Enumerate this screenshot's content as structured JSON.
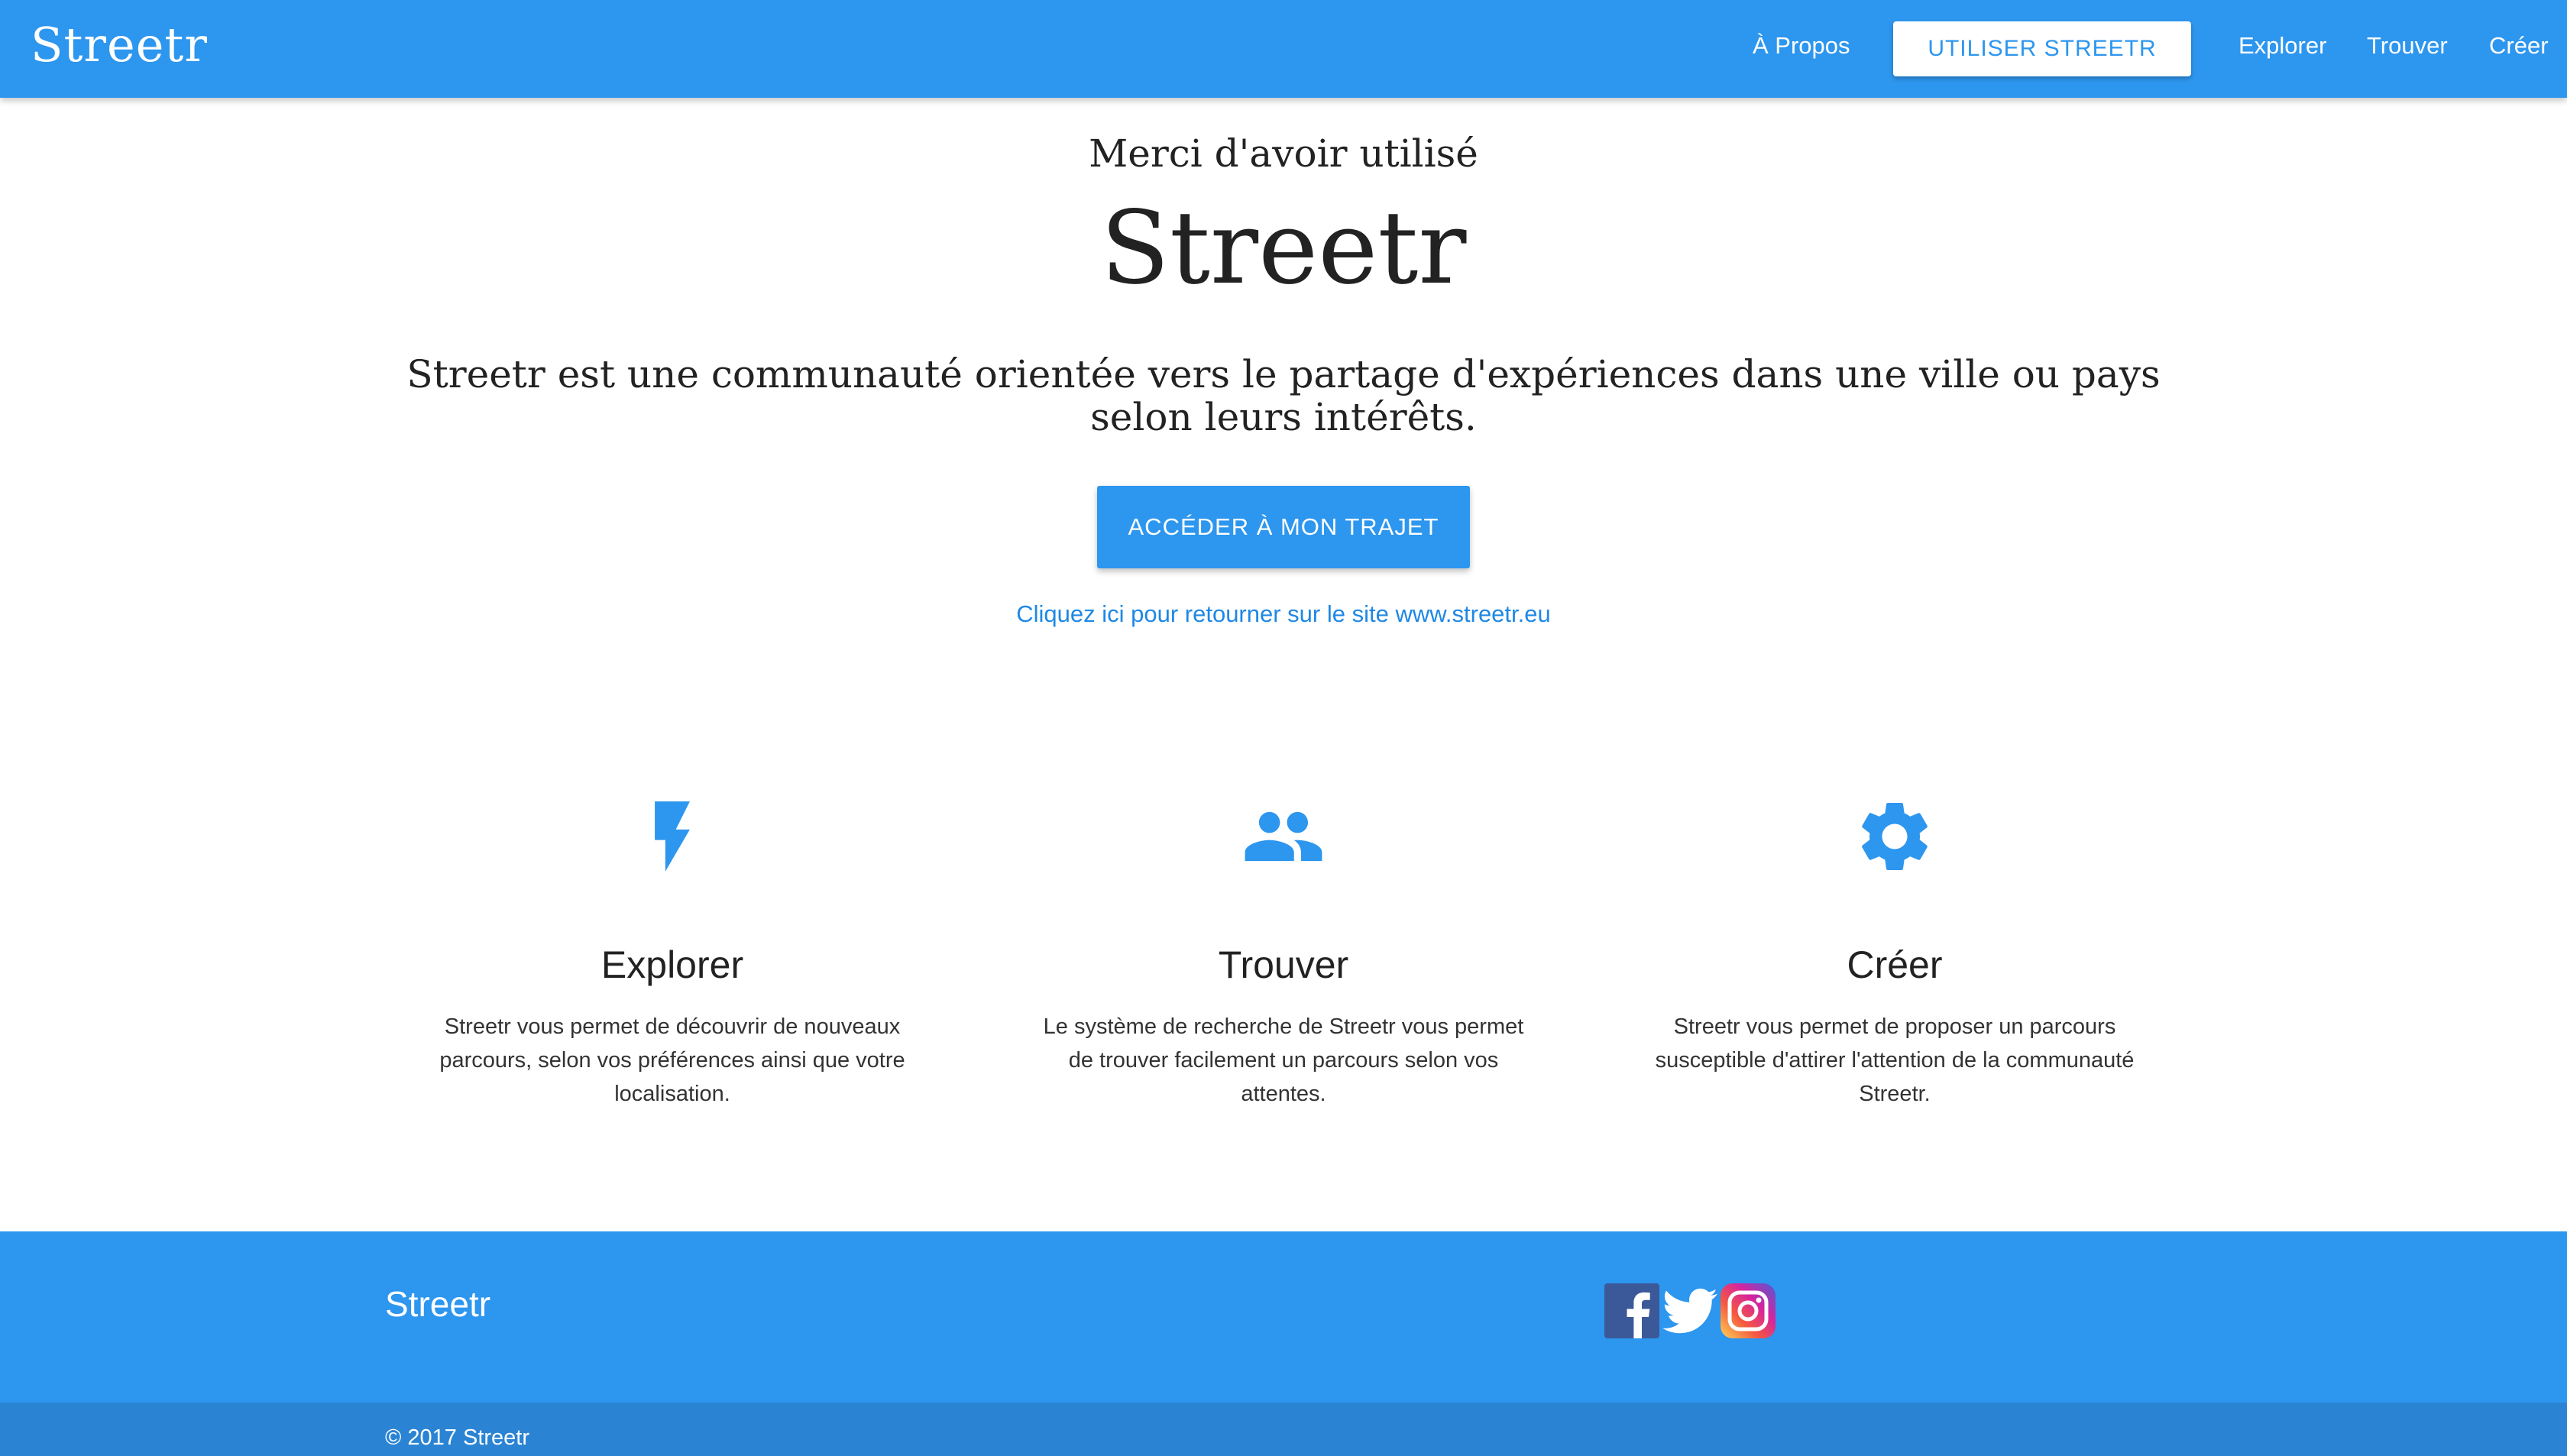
{
  "navbar": {
    "brand": "Streetr",
    "links": [
      "À Propos",
      "Explorer",
      "Trouver",
      "Créer"
    ],
    "cta_label": "UTILISER STREETR"
  },
  "hero": {
    "subtitle": "Merci d'avoir utilisé",
    "title": "Streetr",
    "description": "Streetr est une communauté orientée vers le partage d'expériences dans une ville ou pays selon leurs intérêts.",
    "button_label": "ACCÉDER À MON TRAJET",
    "back_link": "Cliquez ici pour retourner sur le site www.streetr.eu"
  },
  "features": [
    {
      "icon": "flash-icon",
      "title": "Explorer",
      "text": "Streetr vous permet de découvrir de nouveaux parcours, selon vos préférences ainsi que votre localisation."
    },
    {
      "icon": "people-icon",
      "title": "Trouver",
      "text": "Le système de recherche de Streetr vous permet de trouver facilement un parcours selon vos attentes."
    },
    {
      "icon": "gear-icon",
      "title": "Créer",
      "text": "Streetr vous permet de proposer un parcours susceptible d'attirer l'attention de la communauté Streetr."
    }
  ],
  "footer": {
    "brand": "Streetr",
    "social": [
      "facebook-icon",
      "twitter-icon",
      "instagram-icon"
    ],
    "copyright": "© 2017 Streetr"
  },
  "colors": {
    "primary": "#2d96ee",
    "footer_bottom": "#2a84d3",
    "link": "#1e88e5"
  }
}
